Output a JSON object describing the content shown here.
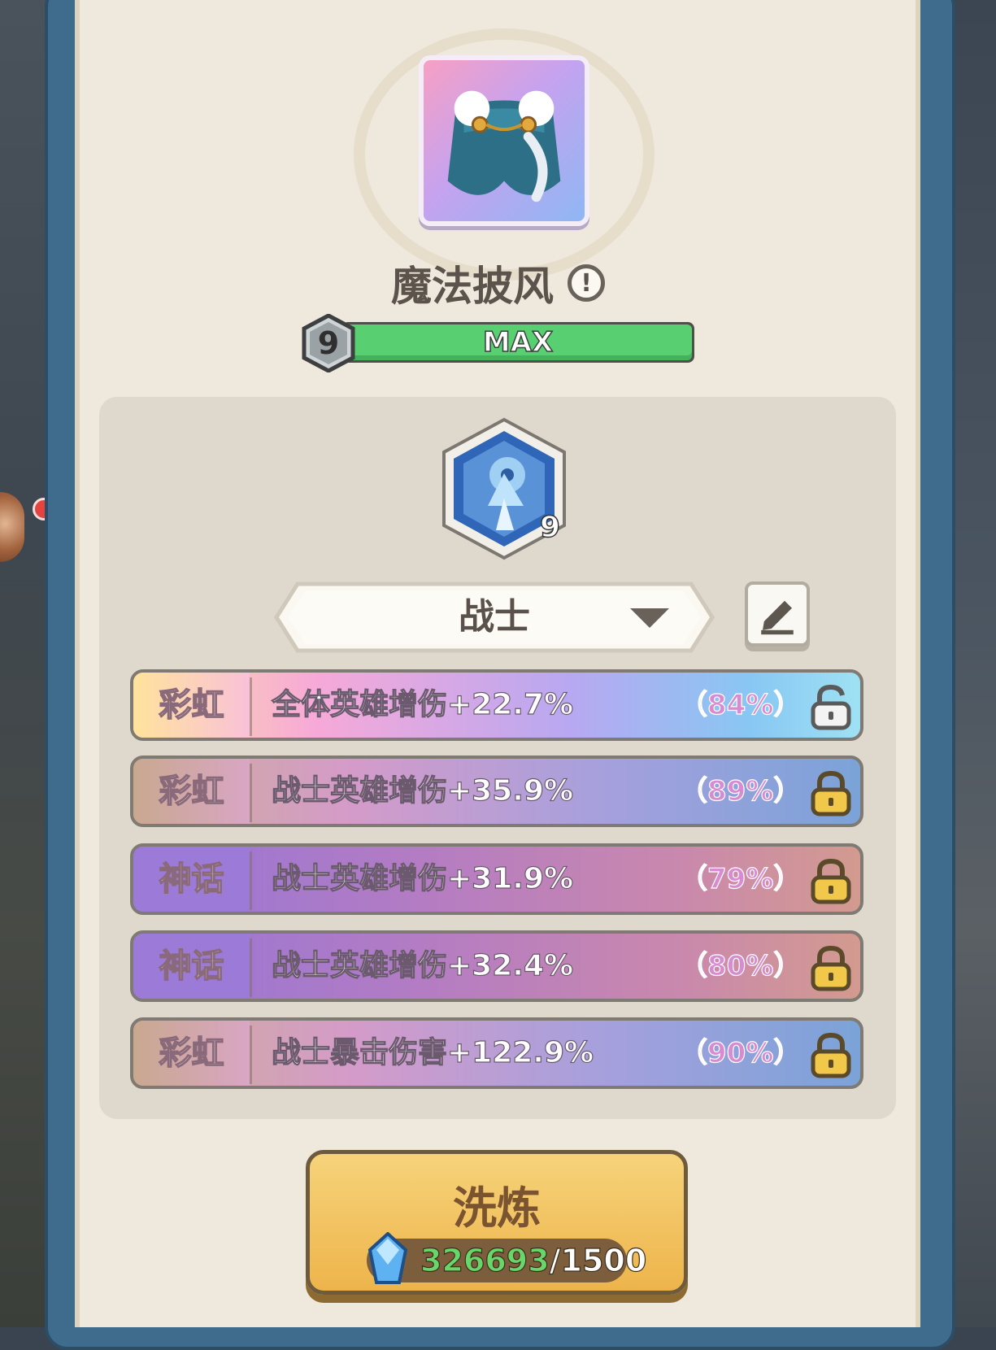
{
  "item": {
    "name": "魔法披风",
    "level": "9",
    "level_bar_label": "MAX",
    "level_progress": 1.0
  },
  "class_badge": {
    "level": "9"
  },
  "class_selector": {
    "selected": "战士"
  },
  "attributes": [
    {
      "rarity": "彩虹",
      "text": "全体英雄增伤+22.7%",
      "percent": "（84%）",
      "locked": false
    },
    {
      "rarity": "彩虹",
      "text": "战士英雄增伤+35.9%",
      "percent": "（89%）",
      "locked": true
    },
    {
      "rarity": "神话",
      "text": "战士英雄增伤+31.9%",
      "percent": "（79%）",
      "locked": true
    },
    {
      "rarity": "神话",
      "text": "战士英雄增伤+32.4%",
      "percent": "（80%）",
      "locked": true
    },
    {
      "rarity": "彩虹",
      "text": "战士暴击伤害+122.9%",
      "percent": "（90%）",
      "locked": true
    }
  ],
  "refine_button": {
    "label": "洗炼",
    "cost_have": "326693",
    "cost_need": "/1500"
  },
  "colors": {
    "level_bar_fill": "#58cf70",
    "rainbow": "#f9c1d8",
    "myth": "#9c7ad7",
    "button": "#eeb44b"
  },
  "icons": [
    "cape-item-icon",
    "info-icon",
    "level-hexagon-icon",
    "warrior-class-icon",
    "dropdown-arrow-icon",
    "edit-icon",
    "unlock-icon",
    "lock-icon",
    "gem-icon"
  ]
}
